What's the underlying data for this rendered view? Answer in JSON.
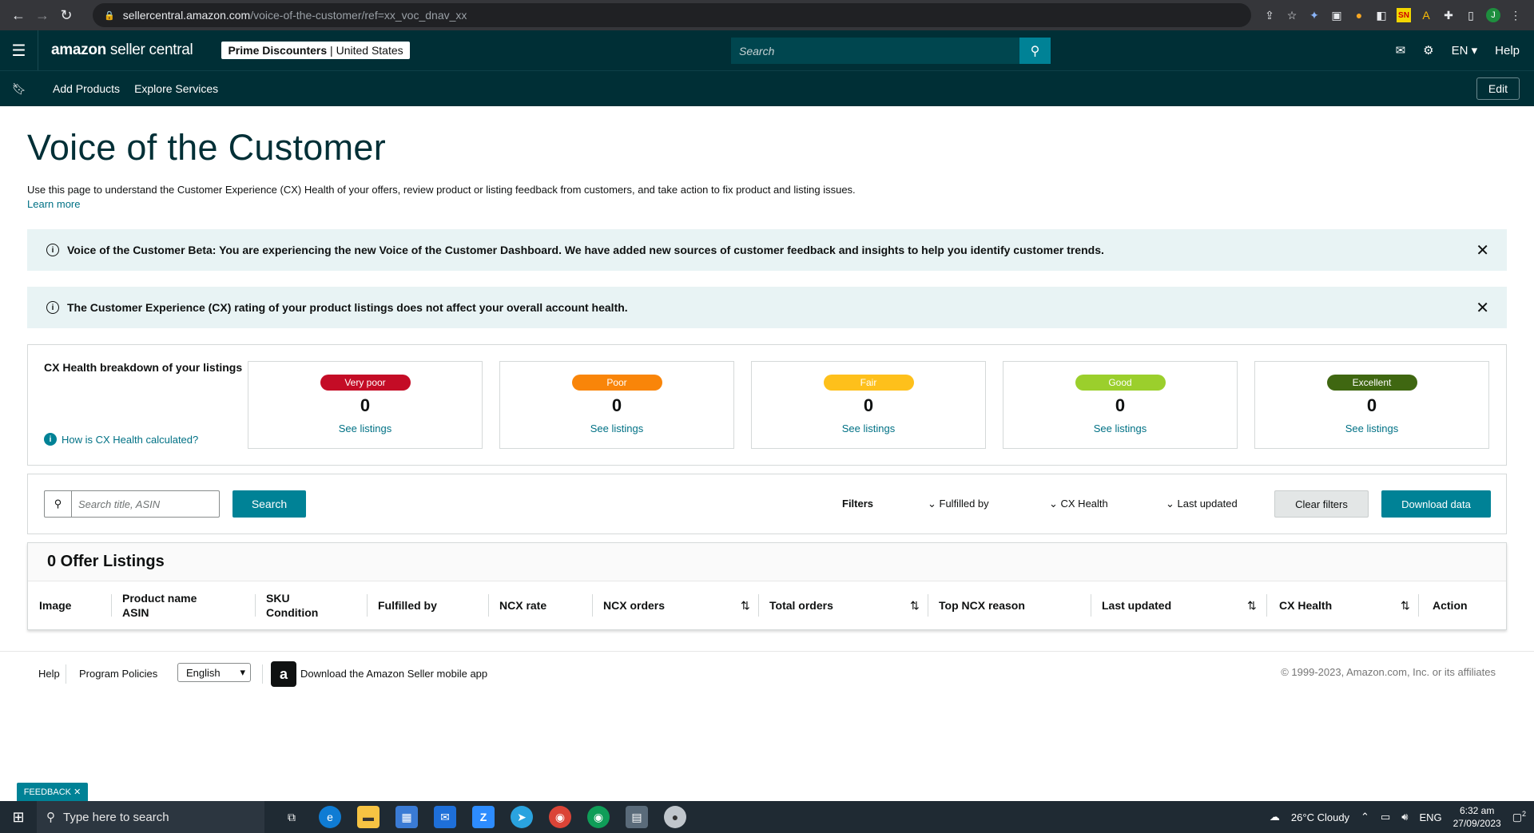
{
  "browser": {
    "url_host": "sellercentral.amazon.com",
    "url_path": "/voice-of-the-customer/ref=xx_voc_dnav_xx",
    "profile_initial": "J"
  },
  "header": {
    "logo_bold": "amazon",
    "logo_rest": " seller central",
    "account_name": "Prime Discounters",
    "account_region": "United States",
    "search_placeholder": "Search",
    "language": "EN",
    "help": "Help"
  },
  "subnav": {
    "items": [
      "Add Products",
      "Explore Services"
    ],
    "edit": "Edit"
  },
  "page": {
    "title": "Voice of the Customer",
    "intro": "Use this page to understand the Customer Experience (CX) Health of your offers, review product or listing feedback from customers, and take action to fix product and listing issues.",
    "learn_more": "Learn more"
  },
  "alerts": [
    {
      "text": "Voice of the Customer Beta: You are experiencing the new Voice of the Customer Dashboard. We have added new sources of customer feedback and insights to help you identify customer trends."
    },
    {
      "text": "The Customer Experience (CX) rating of your product listings does not affect your overall account health."
    }
  ],
  "health": {
    "label": "CX Health breakdown of your listings",
    "how_link": "How is CX Health calculated?",
    "cards": [
      {
        "label": "Very poor",
        "count": "0",
        "link": "See listings",
        "color": "#c40c26"
      },
      {
        "label": "Poor",
        "count": "0",
        "link": "See listings",
        "color": "#f98509"
      },
      {
        "label": "Fair",
        "count": "0",
        "link": "See listings",
        "color": "#fec01b"
      },
      {
        "label": "Good",
        "count": "0",
        "link": "See listings",
        "color": "#9bcf2c"
      },
      {
        "label": "Excellent",
        "count": "0",
        "link": "See listings",
        "color": "#3f6711"
      }
    ]
  },
  "filters": {
    "search_placeholder": "Search title, ASIN",
    "search_button": "Search",
    "filters_label": "Filters",
    "fulfilled_by": "Fulfilled by",
    "cx_health": "CX Health",
    "last_updated": "Last updated",
    "clear": "Clear filters",
    "download": "Download data"
  },
  "offers": {
    "title": "0 Offer Listings",
    "columns": {
      "image": "Image",
      "product_name": "Product name",
      "asin": "ASIN",
      "sku": "SKU",
      "condition": "Condition",
      "fulfilled_by": "Fulfilled by",
      "ncx_rate": "NCX rate",
      "ncx_orders": "NCX orders",
      "total_orders": "Total orders",
      "top_reason": "Top NCX reason",
      "last_updated": "Last updated",
      "cx_health": "CX Health",
      "action": "Action"
    }
  },
  "footer": {
    "help": "Help",
    "policies": "Program Policies",
    "language": "English",
    "app": "Download the Amazon Seller mobile app",
    "copyright": "© 1999-2023, Amazon.com, Inc. or its affiliates"
  },
  "feedback": "FEEDBACK",
  "taskbar": {
    "search": "Type here to search",
    "weather": "26°C  Cloudy",
    "lang": "ENG",
    "time": "6:32 am",
    "date": "27/09/2023",
    "notifications": "2"
  }
}
